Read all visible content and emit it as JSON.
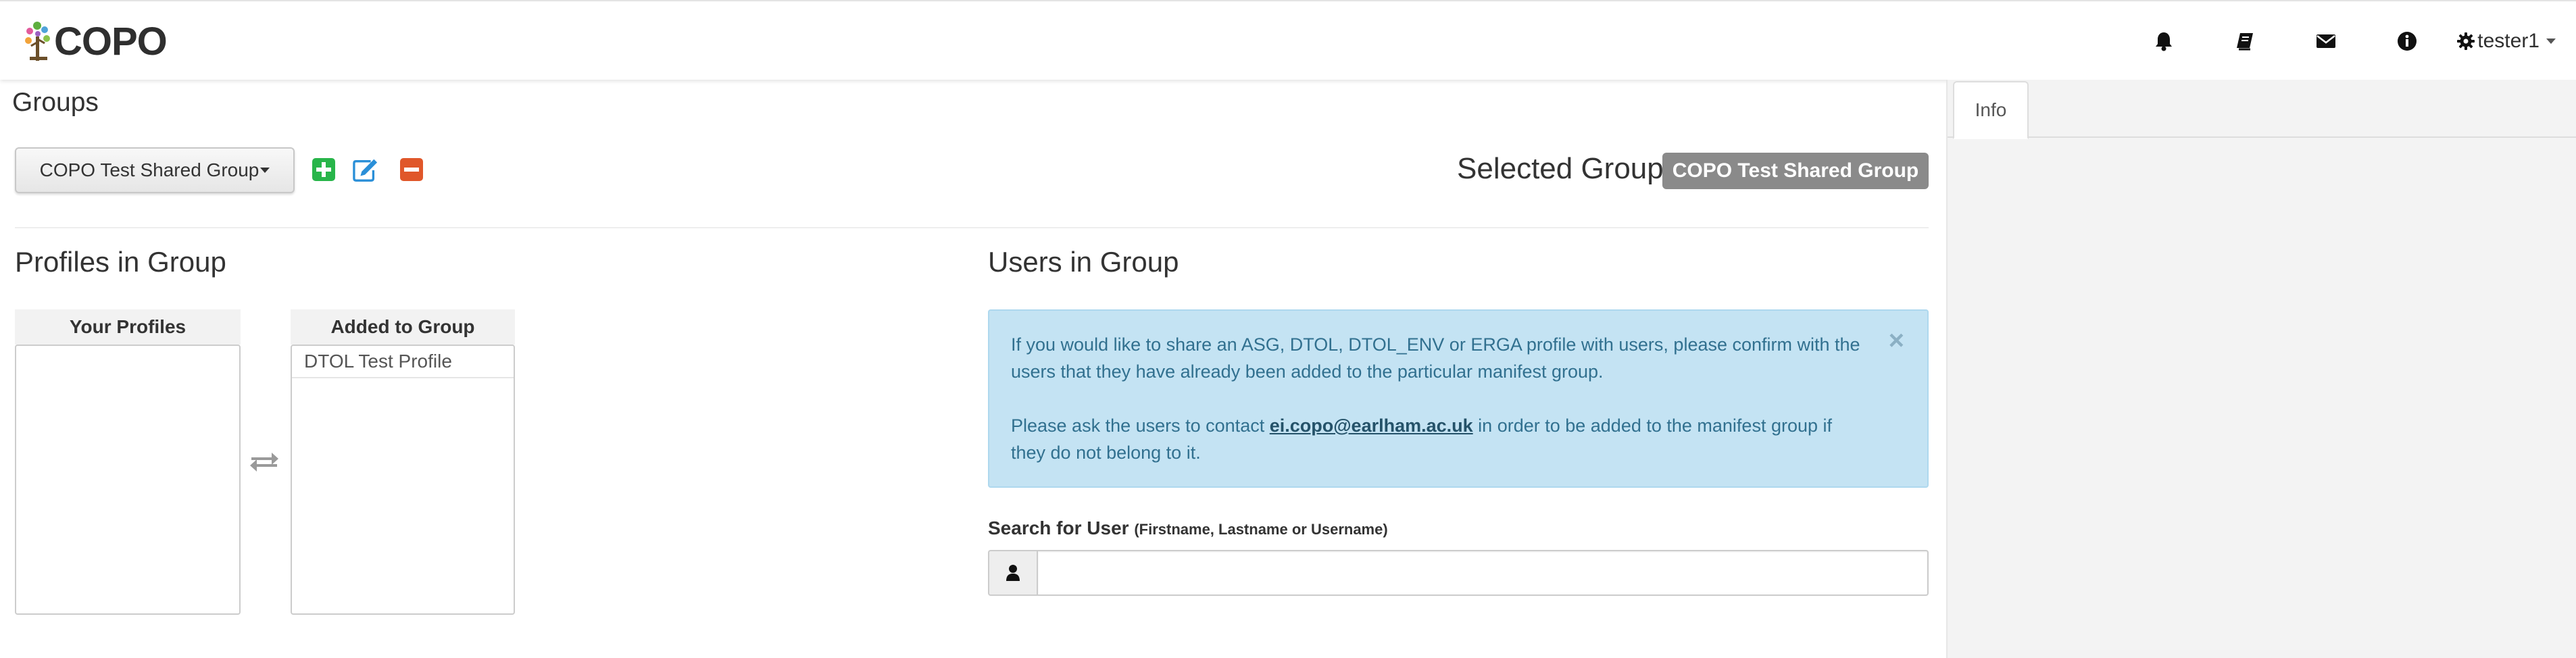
{
  "app": {
    "brand": "COPO"
  },
  "navbar": {
    "icons": [
      "bell-icon",
      "book-icon",
      "envelope-icon",
      "info-circle-icon"
    ],
    "user": {
      "icon": "gear-icon",
      "name": "tester1"
    }
  },
  "page": {
    "title": "Groups"
  },
  "toolbar": {
    "group_dropdown": "COPO Test Shared Group",
    "add_icon": "plus-square-icon",
    "edit_icon": "edit-icon",
    "remove_icon": "minus-square-icon",
    "colors": {
      "add": "#28b54a",
      "edit": "#2a8fd8",
      "remove": "#e0572a"
    }
  },
  "selected_group": {
    "label": "Selected Group:",
    "badge": "COPO Test Shared Group"
  },
  "profiles_section": {
    "title": "Profiles in Group",
    "your_profiles": {
      "header": "Your Profiles",
      "items": []
    },
    "added_to_group": {
      "header": "Added to Group",
      "items": [
        "DTOL Test Profile"
      ]
    },
    "swap_icon": "exchange-icon"
  },
  "users_section": {
    "title": "Users in Group",
    "alert": {
      "text1": "If you would like to share an ASG, DTOL, DTOL_ENV or ERGA profile with users, please confirm with the users that they have already been added to the particular manifest group.",
      "text2_before": "Please ask the users to contact ",
      "email": "ei.copo@earlham.ac.uk",
      "text2_after": " in order to be added to the manifest group if they do not belong to it.",
      "close": "×",
      "color": "#c4e3f3"
    },
    "search": {
      "label": "Search for User",
      "hint": "(Firstname, Lastname or Username)",
      "icon": "user-icon",
      "value": "",
      "placeholder": ""
    }
  },
  "sidebar": {
    "tabs": [
      {
        "label": "Info",
        "active": true
      }
    ]
  }
}
